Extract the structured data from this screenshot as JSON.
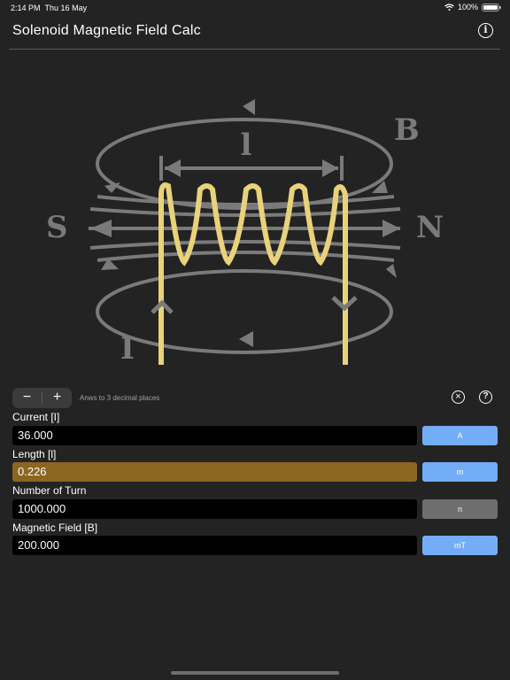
{
  "status_bar": {
    "time": "2:14 PM",
    "date": "Thu 16 May",
    "battery": "100%"
  },
  "header": {
    "title": "Solenoid Magnetic Field Calc",
    "info_icon": "info-icon"
  },
  "diagram": {
    "label_length": "l",
    "label_field": "B",
    "label_south": "S",
    "label_north": "N",
    "label_current": "I"
  },
  "controls": {
    "decrease_label": "−",
    "increase_label": "+",
    "hint": "Anws to 3 decimal places",
    "clear_icon": "close-circle-icon",
    "help_icon": "help-icon"
  },
  "fields": [
    {
      "label": "Current [I]",
      "value": "36.000",
      "unit": "A"
    },
    {
      "label": "Length [l]",
      "value": "0.226",
      "unit": "m"
    },
    {
      "label": "Number of Turn",
      "value": "1000.000",
      "unit": "n"
    },
    {
      "label": "Magnetic Field [B]",
      "value": "200.000",
      "unit": "mT"
    }
  ],
  "colors": {
    "background": "#232323",
    "accent_blue": "#74adf7",
    "active_field": "#8c6521",
    "coil_gold": "#e8d27a",
    "field_line": "#7a7a7a"
  }
}
